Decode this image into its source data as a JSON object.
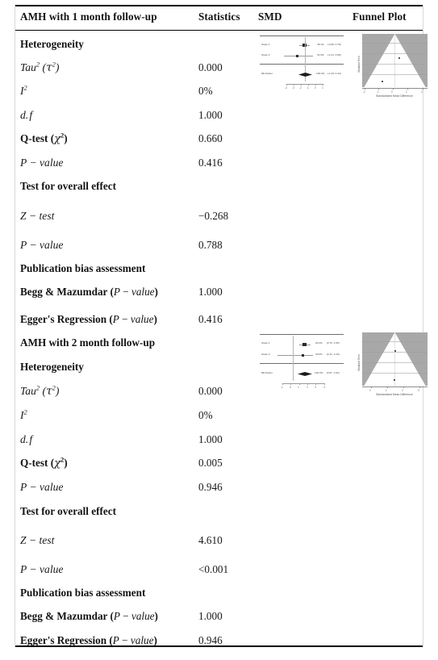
{
  "table": {
    "headers": {
      "col_label_1": "AMH with 1 month follow-up",
      "col_label_2": "AMH with 2 month follow-up",
      "statistics": "Statistics",
      "smd": "SMD",
      "funnel_plot": "Funnel Plot"
    },
    "section_titles": {
      "heterogeneity": "Heterogeneity",
      "overall_effect": "Test for overall effect",
      "publication_bias": "Publication bias assessment"
    },
    "row_labels": {
      "tau2": "Tau² (τ²)",
      "i2": "I²",
      "df": "d. f",
      "qtest": "Q-test (χ²)",
      "pvalue": "P − value",
      "ztest": "Z − test",
      "begg": "Begg & Mazumdar (P − value)",
      "egger": "Egger's Regression (P − value)"
    },
    "block1": {
      "tau2": "0.000",
      "i2": "0%",
      "df": "1.000",
      "qtest": "0.660",
      "q_pvalue": "0.416",
      "ztest": "−0.268",
      "z_pvalue": "0.788",
      "begg": "1.000",
      "egger": "0.416"
    },
    "block2": {
      "tau2": "0.000",
      "i2": "0%",
      "df": "1.000",
      "qtest": "0.005",
      "q_pvalue": "0.946",
      "ztest": "4.610",
      "z_pvalue": "<0.001",
      "begg": "1.000",
      "egger": "0.946"
    }
  },
  "chart_data": [
    {
      "type": "forest",
      "id": "forest-plot-1",
      "title": "SMD forest plot, AMH with 1 month follow-up",
      "xlabel": "",
      "xlim": [
        -4,
        1
      ],
      "xticks": [
        "-4",
        "-3",
        "-2",
        "-1",
        "0",
        "1"
      ],
      "studies": [
        {
          "label": "Study 1",
          "weight": "48.1%",
          "effect": "-0.10",
          "ci": "[-0.98, 0.78]",
          "smd": -0.1,
          "ci_low": -0.98,
          "ci_high": 0.78
        },
        {
          "label": "Study 2",
          "weight": "51.9%",
          "effect": "-0.72",
          "ci": "[-2.31, 0.88]",
          "smd": -0.72,
          "ci_low": -2.31,
          "ci_high": 0.88
        }
      ],
      "summary": {
        "label": "RE Model",
        "weight": "100.0%",
        "effect": "-0.37",
        "ci": "[-1.09, 0.34]",
        "smd": -0.37,
        "ci_low": -1.09,
        "ci_high": 0.34
      }
    },
    {
      "type": "funnel",
      "id": "funnel-plot-1",
      "title": "Funnel plot, AMH with 1 month follow-up",
      "xlabel": "Standardized Mean Difference",
      "ylabel": "Standard Error",
      "xticks": [
        "-2",
        "-1",
        "0",
        "1",
        "2"
      ],
      "points": [
        {
          "x": 0.1,
          "se": 0.45
        },
        {
          "x": -0.55,
          "se": 0.82
        }
      ]
    },
    {
      "type": "forest",
      "id": "forest-plot-2",
      "title": "SMD forest plot, AMH with 2 month follow-up",
      "xlabel": "",
      "xlim": [
        -1,
        4
      ],
      "xticks": [
        "-1",
        "0",
        "1",
        "2",
        "3",
        "4"
      ],
      "studies": [
        {
          "label": "Study 1",
          "weight": "60.4%",
          "effect": "1.35",
          "ci": "[0.75, 1.95]",
          "smd": 1.35,
          "ci_low": 0.75,
          "ci_high": 1.95
        },
        {
          "label": "Study 2",
          "weight": "39.6%",
          "effect": "1.29",
          "ci": "[0.41, 2.18]",
          "smd": 1.29,
          "ci_low": 0.41,
          "ci_high": 2.18
        }
      ],
      "summary": {
        "label": "RE Model",
        "weight": "100.0%",
        "effect": "1.34",
        "ci": "[0.87, 1.82]",
        "smd": 1.34,
        "ci_low": 0.87,
        "ci_high": 1.82
      }
    },
    {
      "type": "funnel",
      "id": "funnel-plot-2",
      "title": "Funnel plot, AMH with 2 month follow-up",
      "xlabel": "Standardized Mean Difference",
      "ylabel": "Standard Error",
      "xticks": [
        "0",
        "1",
        "2",
        "3"
      ],
      "points": [
        {
          "x": 1.35,
          "se": 0.33
        },
        {
          "x": 1.3,
          "se": 0.86
        }
      ]
    }
  ]
}
